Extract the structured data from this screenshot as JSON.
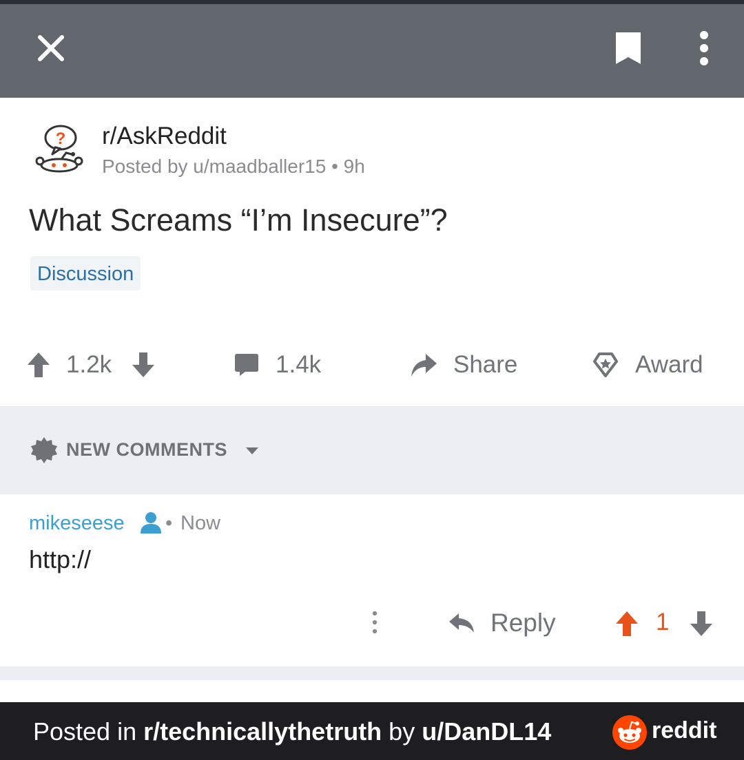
{
  "colors": {
    "topbar": "#62676e",
    "accent_orange": "#e8531c",
    "username_blue": "#3c9fd1",
    "flair_text": "#2b6fa8",
    "muted": "#707378",
    "footer_bg": "#1e1e20"
  },
  "icons": {
    "close": "close-icon",
    "bookmark": "bookmark-icon",
    "more": "more-vertical-icon",
    "subreddit": "askreddit-icon",
    "upvote": "upvote-arrow-icon",
    "downvote": "downvote-arrow-icon",
    "comment": "comment-bubble-icon",
    "share": "share-arrow-icon",
    "award": "award-icon",
    "new_comments": "new-comments-badge-icon",
    "caret": "caret-down-icon",
    "user": "user-icon",
    "reply": "reply-arrow-icon",
    "reddit": "reddit-logo-icon"
  },
  "post": {
    "subreddit": "r/AskReddit",
    "posted_by": "Posted by u/maadballer15 • 9h",
    "title": "What Screams “I’m Insecure”?",
    "flair": "Discussion",
    "upvotes": "1.2k",
    "comments": "1.4k",
    "share_label": "Share",
    "award_label": "Award"
  },
  "sort": {
    "label": "NEW COMMENTS"
  },
  "comment": {
    "username": "mikeseese",
    "separator": "•",
    "time": "Now",
    "body": "http://",
    "reply_label": "Reply",
    "score": "1"
  },
  "footer": {
    "prefix": "Posted in ",
    "subreddit": "r/technicallythetruth",
    "by": " by ",
    "user": "u/DanDL14",
    "brand": "reddit"
  }
}
